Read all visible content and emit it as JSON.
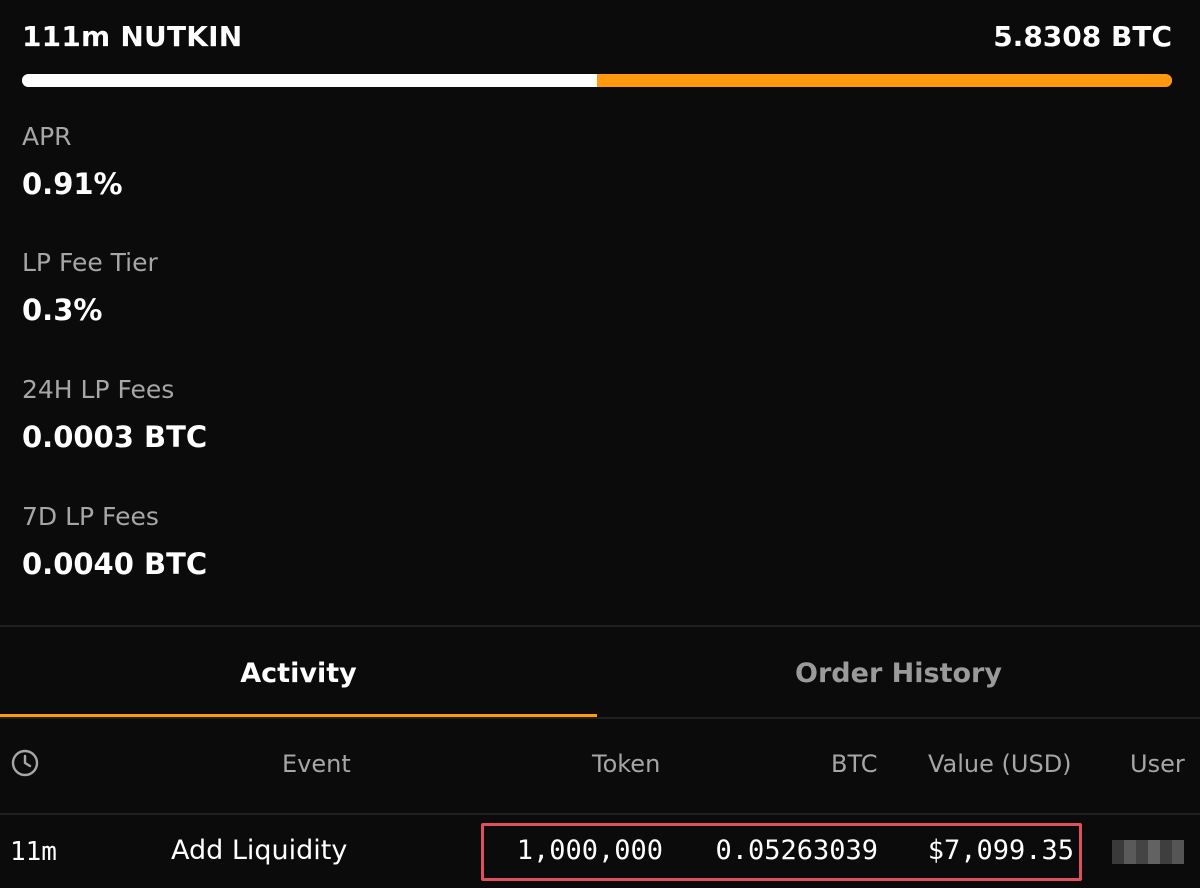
{
  "pair": {
    "name": "111m NUTKIN",
    "total": "5.8308 BTC",
    "ratio_left_fraction": 0.5,
    "colors": {
      "left": "#ffffff",
      "right": "#ff9a0e"
    }
  },
  "stats": {
    "apr": {
      "label": "APR",
      "value": "0.91%"
    },
    "fee_tier": {
      "label": "LP Fee Tier",
      "value": "0.3%"
    },
    "fees_24h": {
      "label": "24H LP Fees",
      "value": "0.0003 BTC"
    },
    "fees_7d": {
      "label": "7D LP Fees",
      "value": "0.0040 BTC"
    }
  },
  "tabs": [
    {
      "label": "Activity",
      "active": true
    },
    {
      "label": "Order History",
      "active": false
    }
  ],
  "table": {
    "time_icon": "clock-icon",
    "headers": {
      "event": "Event",
      "token": "Token",
      "btc": "BTC",
      "value": "Value (USD)",
      "user": "User"
    },
    "rows": [
      {
        "time": "11m",
        "event": "Add Liquidity",
        "token": "1,000,000",
        "btc": "0.05263039",
        "value": "$7,099.35",
        "user_icon": "pixelated-avatar-icon"
      }
    ]
  },
  "accent_color": "#ff9a0e",
  "highlight_color": "#e0505a"
}
